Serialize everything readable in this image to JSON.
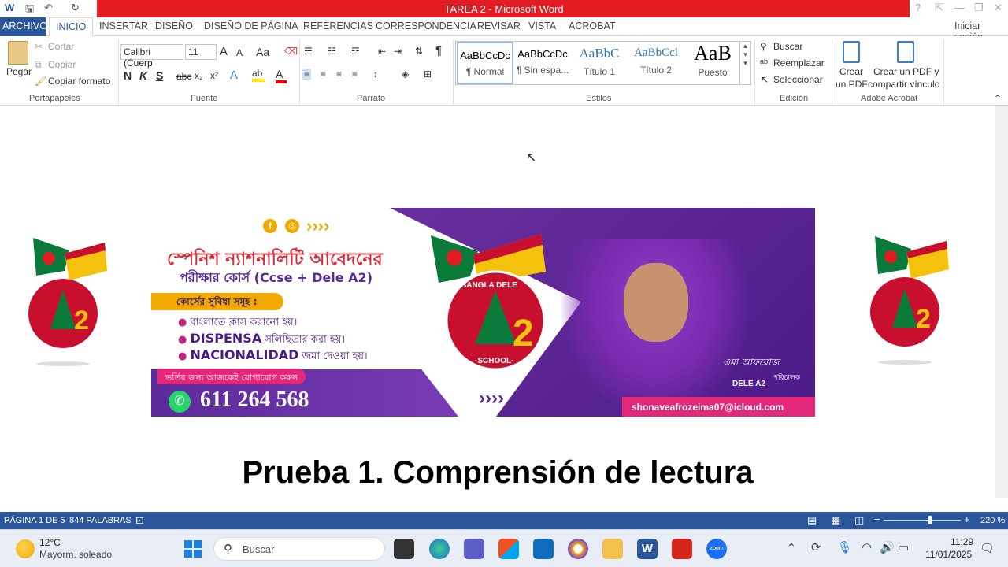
{
  "window": {
    "title": "TAREA 2 -  Microsoft Word",
    "sign_in": "Iniciar sesión",
    "controls": [
      "?",
      "⇱",
      "—",
      "❐",
      "✕"
    ]
  },
  "tabs": [
    "ARCHIVO",
    "INICIO",
    "INSERTAR",
    "DISEÑO",
    "DISEÑO DE PÁGINA",
    "REFERENCIAS",
    "CORRESPONDENCIA",
    "REVISAR",
    "VISTA",
    "ACROBAT"
  ],
  "ribbon": {
    "clipboard": {
      "paste": "Pegar",
      "cut": "Cortar",
      "copy": "Copiar",
      "format_painter": "Copiar formato",
      "label": "Portapapeles"
    },
    "font": {
      "family": "Calibri (Cuerp",
      "size": "11",
      "grow": "A",
      "shrink": "A",
      "case": "Aa",
      "bold": "N",
      "italic": "K",
      "underline": "S",
      "strike": "abc",
      "sub": "x₂",
      "sup": "x²",
      "label": "Fuente"
    },
    "paragraph": {
      "label": "Párrafo",
      "pilcrow": "¶"
    },
    "styles": {
      "items": [
        {
          "preview": "AaBbCcDc",
          "name": "¶ Normal"
        },
        {
          "preview": "AaBbCcDc",
          "name": "¶ Sin espa..."
        },
        {
          "preview": "AaBbC",
          "name": "Título 1"
        },
        {
          "preview": "AaBbCcl",
          "name": "Título 2"
        },
        {
          "preview": "AaB",
          "name": "Puesto"
        }
      ],
      "label": "Estilos"
    },
    "editing": {
      "find": "Buscar",
      "replace": "Reemplazar",
      "select": "Seleccionar",
      "label": "Edición"
    },
    "acrobat": {
      "create_pdf_1": "Crear",
      "create_pdf_2": "un PDF",
      "share_1": "Crear un PDF y",
      "share_2": "compartir vínculo",
      "label": "Adobe Acrobat"
    }
  },
  "banner": {
    "line1": "স্পেনিশ ন্যাশনালিটি আবেদনের",
    "line2": "পরীক্ষার কোর্স  (Ccse + Dele A2)",
    "benefits_title": "কোর্সের সুবিধা সমূহ :",
    "bullet1": "বাংলাতে ক্লাস করানো হয়।",
    "bullet2_bold": "DISPENSA",
    "bullet2_rest": " সলিছিতার করা হয়।",
    "bullet3_bold": "NACIONALIDAD",
    "bullet3_rest": " জমা দেওয়া হয়।",
    "contact_cta": "ভর্তির জন্য আজকেই যোগাযোগ করুন",
    "phone": "611 264 568",
    "arrows": "››››",
    "email": "shonaveafrozeima07@icloud.com",
    "person_name": "এমা আফরোজ",
    "person_role": "পরিচালক",
    "person_org": "DELE A2",
    "logo_top": "BANGLA DELE",
    "logo_mid": "A2",
    "logo_bottom": "·SCHOOL·"
  },
  "document": {
    "heading": "Prueba 1. Comprensión de lectura"
  },
  "status": {
    "page": "PÁGINA 1 DE 5",
    "words": "844 PALABRAS",
    "zoom": "220 %",
    "zoom_level": 0.58
  },
  "taskbar": {
    "weather_temp": "12°C",
    "weather_desc": "Mayorm. soleado",
    "search": "Buscar",
    "time": "11:29",
    "date": "11/01/2025"
  }
}
